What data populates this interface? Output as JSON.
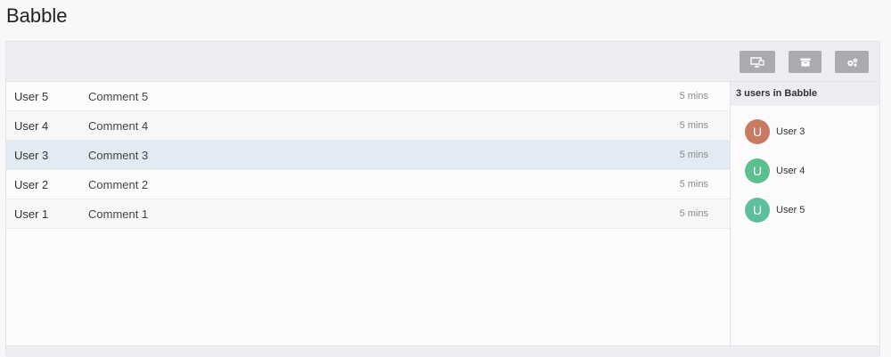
{
  "app": {
    "title": "Babble"
  },
  "toolbar": {
    "buttons": [
      {
        "icon": "screen-share-icon"
      },
      {
        "icon": "archive-icon"
      },
      {
        "icon": "settings-icon"
      }
    ],
    "button_color": "#a9abae"
  },
  "messages": [
    {
      "user": "User 5",
      "comment": "Comment 5",
      "time": "5 mins"
    },
    {
      "user": "User 4",
      "comment": "Comment 4",
      "time": "5 mins"
    },
    {
      "user": "User 3",
      "comment": "Comment 3",
      "time": "5 mins"
    },
    {
      "user": "User 2",
      "comment": "Comment 2",
      "time": "5 mins"
    },
    {
      "user": "User 1",
      "comment": "Comment 1",
      "time": "5 mins"
    }
  ],
  "highlight_color": "#e2eaf4",
  "sidebar": {
    "header": "3 users in Babble",
    "users": [
      {
        "initial": "U",
        "name": "User 3",
        "color": "#c77b63"
      },
      {
        "initial": "U",
        "name": "User 4",
        "color": "#5cc08e"
      },
      {
        "initial": "U",
        "name": "User 5",
        "color": "#5cc09c"
      }
    ]
  }
}
